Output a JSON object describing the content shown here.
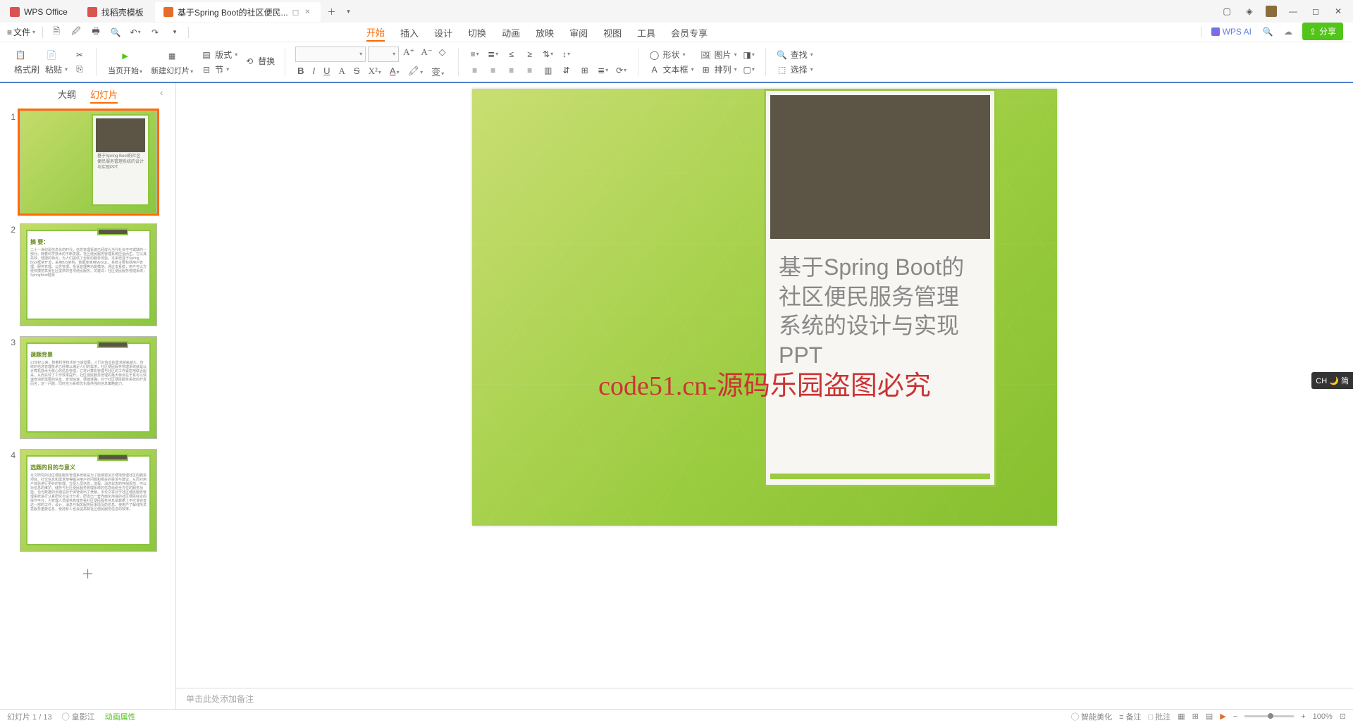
{
  "titlebar": {
    "tabs": [
      {
        "icon": "wps",
        "label": "WPS Office"
      },
      {
        "icon": "tpl",
        "label": "找稻壳模板"
      },
      {
        "icon": "ppt",
        "label": "基于Spring Boot的社区便民..."
      }
    ]
  },
  "quickbar": {
    "menu_icon": "≡",
    "file": "文件"
  },
  "menu": {
    "tabs": [
      "开始",
      "插入",
      "设计",
      "切换",
      "动画",
      "放映",
      "审阅",
      "视图",
      "工具",
      "会员专享"
    ],
    "active": 0,
    "wpsai": "WPS AI",
    "share": "分享"
  },
  "ribbon": {
    "format_painter": "格式刷",
    "paste": "粘贴",
    "start_from": "当页开始",
    "new_slide": "新建幻灯片",
    "layout": "版式",
    "section": "节",
    "replace": "替换",
    "shape": "形状",
    "picture": "图片",
    "textbox": "文本框",
    "arrange": "排列",
    "find": "查找",
    "select": "选择"
  },
  "sidebar": {
    "tab_outline": "大纲",
    "tab_slides": "幻灯片",
    "slides": [
      {
        "num": "1",
        "title": "基于Spring Boot的社区便民服务管理系统的设计与实现PPT"
      },
      {
        "num": "2",
        "title": "摘  要：",
        "body": "二十一世纪是信息化的时代，信息管理系统已经成为当代社会不可或缺的一部分。随着科学技术的不断发展，社区便民服务管理系统应运而生。它以其高效、便捷的特点，为人们提供了全新的服务体验。本系统基于Spring Boot框架开发，采用B/S架构，数据库使用MySQL。系统主要包括用户管理、服务管理、公告管理、投诉管理等功能模块。通过本系统，用户可以方便快捷地享受社区提供的各项便民服务。关键词：社区便民服务管理系统；SpringBoot框架"
      },
      {
        "num": "3",
        "title": "课题背景",
        "body": "21世纪以来，随着科学技术的飞速发展，人们对信息的需求越来越大。传统的信息管理技术已经难以满足人们的需求，社区便民服务管理系统就是以计算机技术为核心的信息管理，它将计算机管理与社区的工作紧密地联合起来，从而实现了工作效率提升。社区便民服务管理的最大特点在于其可以快速查询所需要的信息，查询快速、便捷准确。对于社区便民服务系统的开发而言，这一问题，同时也为系统优化提供强的信息策略能力。"
      },
      {
        "num": "4",
        "title": "选题的目的与意义",
        "body": "本文研究的社区便民服务管理系统就是为了能够更加方便地管理社区的服务项目、社交信息和需求使得解决用户的问题和相关的投诉与建议，从而对用户体验进行更好的管理。方便人员信息，流程、消息状态的存储规范，可以对信息的维护、储存与社区便民服务管理系统的信息给给全方位的服务功能，也为数据的长期沿存于保管做出了贡献。本论文将对于社区便民服务管理系统进行认真研究与设计分析，研发出一套界面化简易的社区便民综合的操作平台，为管理人员提供高效查看社区便民服务信息是数据上不应该完善这一部的工作，设计，消息与相关服务民事情况的信息。使用户了解线所关意服务重要信息，使持有人也会提高制社区便民服务信息的效率。"
      }
    ]
  },
  "slide": {
    "title_line1": "基于Spring Boot的",
    "title_line2": "社区便民服务管理",
    "title_line3": "系统的设计与实现",
    "title_line4": "PPT"
  },
  "watermark": "code51.cn-源码乐园盗图必究",
  "notes_placeholder": "单击此处添加备注",
  "ime_badge": "CH 🌙 简",
  "status": {
    "slide_info": "幻灯片 1 / 13",
    "play": "◯ 皇影江",
    "animate": "动画属性",
    "smart": "◯ 智能美化",
    "notes": "≡ 备注",
    "comments": "□ 批注",
    "zoom": "100%"
  }
}
